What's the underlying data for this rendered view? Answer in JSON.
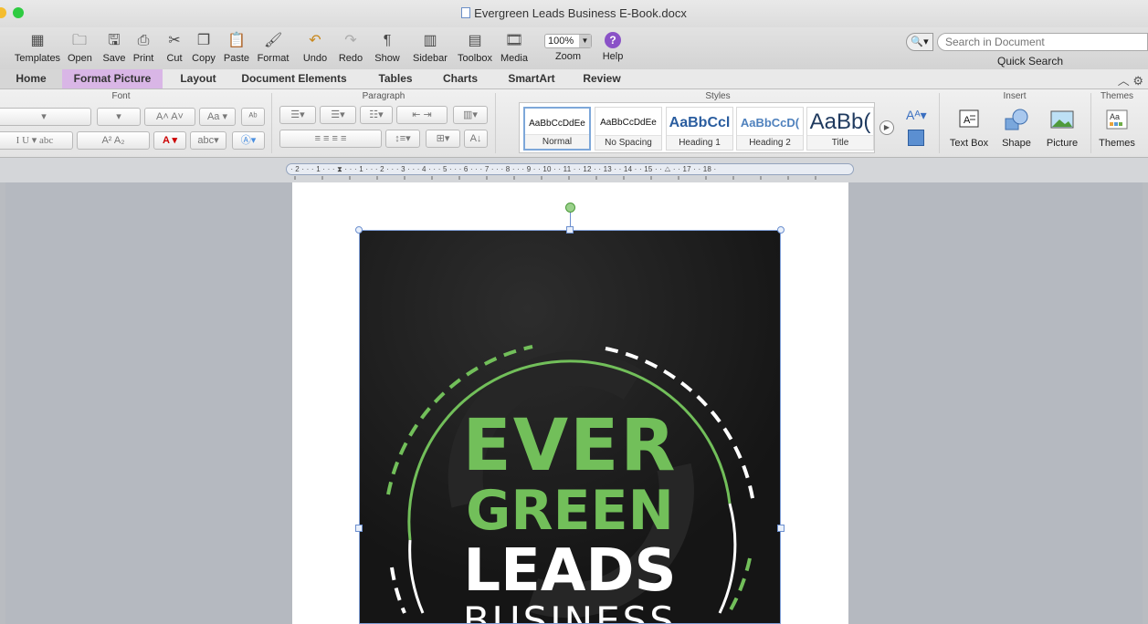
{
  "window": {
    "title": "Evergreen Leads Business E-Book.docx"
  },
  "toolbar": {
    "buttons": [
      {
        "label": "Templates",
        "icon": "templates-icon"
      },
      {
        "label": "Open",
        "icon": "open-icon"
      },
      {
        "label": "Save",
        "icon": "save-icon"
      },
      {
        "label": "Print",
        "icon": "print-icon"
      },
      {
        "label": "Cut",
        "icon": "scissors-icon"
      },
      {
        "label": "Copy",
        "icon": "copy-icon"
      },
      {
        "label": "Paste",
        "icon": "paste-icon"
      },
      {
        "label": "Format",
        "icon": "format-brush-icon"
      },
      {
        "label": "Undo",
        "icon": "undo-icon"
      },
      {
        "label": "Redo",
        "icon": "redo-icon"
      },
      {
        "label": "Show",
        "icon": "pilcrow-icon"
      },
      {
        "label": "Sidebar",
        "icon": "sidebar-icon"
      },
      {
        "label": "Toolbox",
        "icon": "toolbox-icon"
      },
      {
        "label": "Media",
        "icon": "media-icon"
      },
      {
        "label": "Zoom",
        "icon": "zoom-icon"
      },
      {
        "label": "Help",
        "icon": "help-icon"
      }
    ],
    "zoom_value": "100%",
    "help_glyph": "?",
    "search_placeholder": "Search in Document",
    "search_label": "Quick Search"
  },
  "ribbon_tabs": [
    {
      "label": "Home"
    },
    {
      "label": "Format Picture"
    },
    {
      "label": "Layout"
    },
    {
      "label": "Document Elements"
    },
    {
      "label": "Tables"
    },
    {
      "label": "Charts"
    },
    {
      "label": "SmartArt"
    },
    {
      "label": "Review"
    }
  ],
  "ribbon": {
    "group_labels": {
      "font": "Font",
      "paragraph": "Paragraph",
      "styles": "Styles",
      "insert": "Insert",
      "themes": "Themes"
    },
    "styles": [
      {
        "sample": "AaBbCcDdEe",
        "name": "Normal"
      },
      {
        "sample": "AaBbCcDdEe",
        "name": "No Spacing"
      },
      {
        "sample": "AaBbCcl",
        "name": "Heading 1"
      },
      {
        "sample": "AaBbCcD(",
        "name": "Heading 2"
      },
      {
        "sample": "AaBb(",
        "name": "Title"
      }
    ],
    "insert_items": [
      {
        "label": "Text Box",
        "icon": "text-box-icon"
      },
      {
        "label": "Shape",
        "icon": "shape-icon"
      },
      {
        "label": "Picture",
        "icon": "picture-icon"
      }
    ],
    "themes_label": "Themes"
  },
  "ruler": {
    "text": "· 2 · · · 1 · · · ⧗ · · · 1 · · · 2 · · · 3 · · · 4 · · · 5 · · · 6 · · · 7 · · · 8 · · · 9 · · 10 · · 11 · · 12 · · 13 · · 14 · · 15 · · △ · · 17 · · 18 ·"
  },
  "document": {
    "cover_words": [
      "EVER",
      "GREEN",
      "LEADS",
      "BUSINESS"
    ]
  },
  "colors": {
    "ribbon_active_tab": "#d9b6e6",
    "cover_green": "#72bf5a",
    "cover_background": "#151515",
    "selection_handle": "#6c8fcf"
  }
}
